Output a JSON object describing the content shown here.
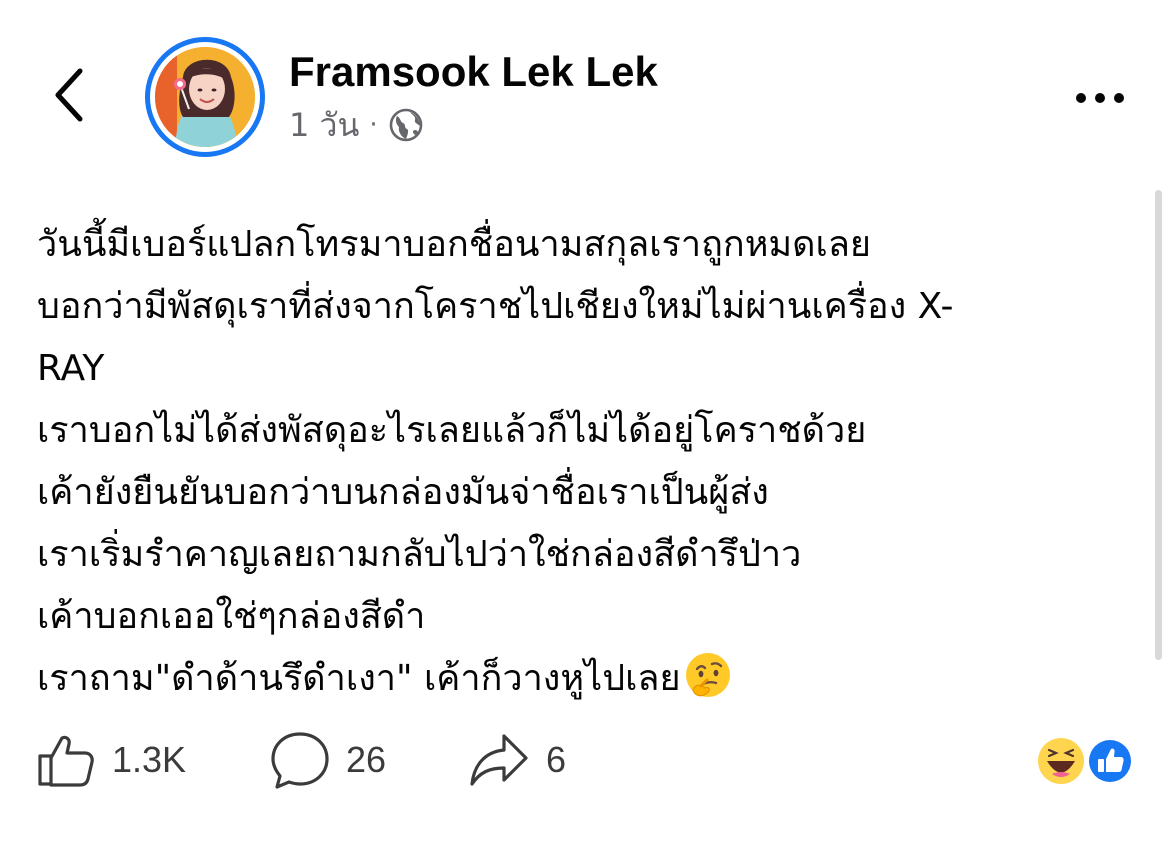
{
  "header": {
    "author_name": "Framsook Lek Lek",
    "time_ago": "1 วัน",
    "separator": "·",
    "privacy_icon": "globe-icon",
    "back_icon": "chevron-left-icon",
    "more_icon": "ellipsis-icon"
  },
  "post": {
    "lines": [
      "วันนี้มีเบอร์แปลกโทรมาบอกชื่อนามสกุลเราถูกหมดเลย",
      "บอกว่ามีพัสดุเราที่ส่งจากโคราชไปเชียงใหม่ไม่ผ่านเครื่อง X-RAY",
      "เราบอกไม่ได้ส่งพัสดุอะไรเลยแล้วก็ไม่ได้อยู่โคราชด้วย",
      "เค้ายังยืนยันบอกว่าบนกล่องมันจ่าชื่อเราเป็นผู้ส่ง",
      "เราเริ่มรำคาญเลยถามกลับไปว่าใช่กล่องสีดำรึป่าว",
      "เค้าบอกเออใช่ๆกล่องสีดำ",
      "เราถาม\"ดำด้านรึดำเงา\" เค้าก็วางหูไปเลย"
    ],
    "line2_part1": "บอกว่ามีพัสดุเราที่ส่งจากโคราชไปเชียงใหม่ไม่ผ่านเครื่อง X-",
    "line2_part2": "RAY",
    "end_emoji": "thinking-face-icon"
  },
  "actions": {
    "like_count": "1.3K",
    "comment_count": "26",
    "share_count": "6",
    "like_icon": "thumbs-up-icon",
    "comment_icon": "comment-bubble-icon",
    "share_icon": "share-arrow-icon"
  },
  "reactions": [
    "haha-reaction-icon",
    "like-reaction-icon"
  ],
  "colors": {
    "accent": "#1877f2",
    "secondary_text": "#65676b",
    "primary_text": "#050505"
  }
}
